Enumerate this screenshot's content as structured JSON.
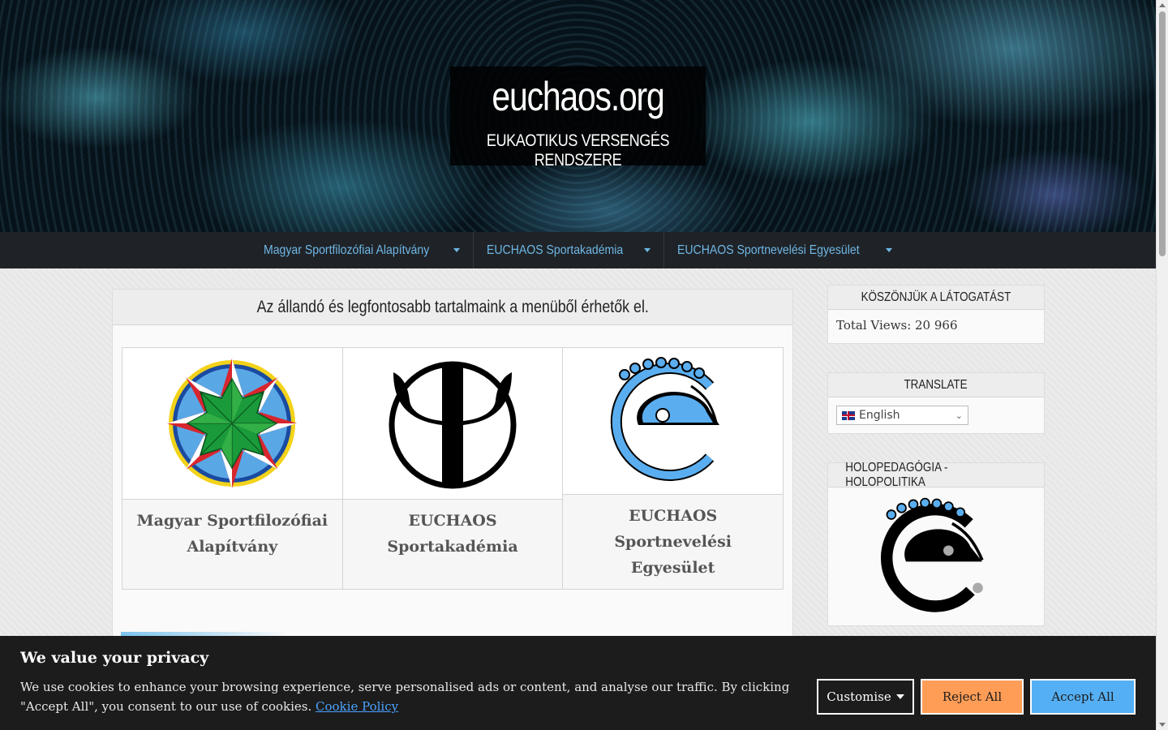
{
  "header": {
    "site_title": "euchaos.org",
    "site_description": "EUKAOTIKUS VERSENGÉS RENDSZERE"
  },
  "nav": {
    "items": [
      {
        "label": "Magyar Sportfilozófiai Alapítvány"
      },
      {
        "label": "EUCHAOS Sportakadémia"
      },
      {
        "label": "EUCHAOS Sportnevelési Egyesület"
      }
    ]
  },
  "main": {
    "heading": "Az állandó és legfontosabb tartalmaink a menüből érhetők el.",
    "cards": [
      {
        "caption": "Magyar Sportfilozófiai Alapítvány",
        "icon": "sportfilozofia-star-logo"
      },
      {
        "caption": "EUCHAOS Sportakadémia",
        "icon": "psi-logo"
      },
      {
        "caption": "EUCHAOS Sportnevelési Egyesület",
        "icon": "euchaos-e-logo"
      }
    ]
  },
  "sidebar": {
    "visits": {
      "title": "KÖSZÖNJÜK A LÁTOGATÁST",
      "text": "Total Views: 20 966"
    },
    "translate": {
      "title": "TRANSLATE",
      "language": "English"
    },
    "holo": {
      "title": "HOLOPEDAGÓGIA - HOLOPOLITIKA"
    }
  },
  "cookie": {
    "title": "We value your privacy",
    "text": "We use cookies to enhance your browsing experience, serve personalised ads or content, and analyse our traffic. By clicking \"Accept All\", you consent to our use of cookies.",
    "policy_link": "Cookie Policy",
    "customise": "Customise",
    "reject": "Reject All",
    "accept": "Accept All"
  },
  "colors": {
    "nav_bg": "#1f2327",
    "nav_link": "#6fb7e6",
    "reject_btn": "#ff9d57",
    "accept_btn": "#55aff4",
    "cookie_bg": "#1c1c1c"
  }
}
